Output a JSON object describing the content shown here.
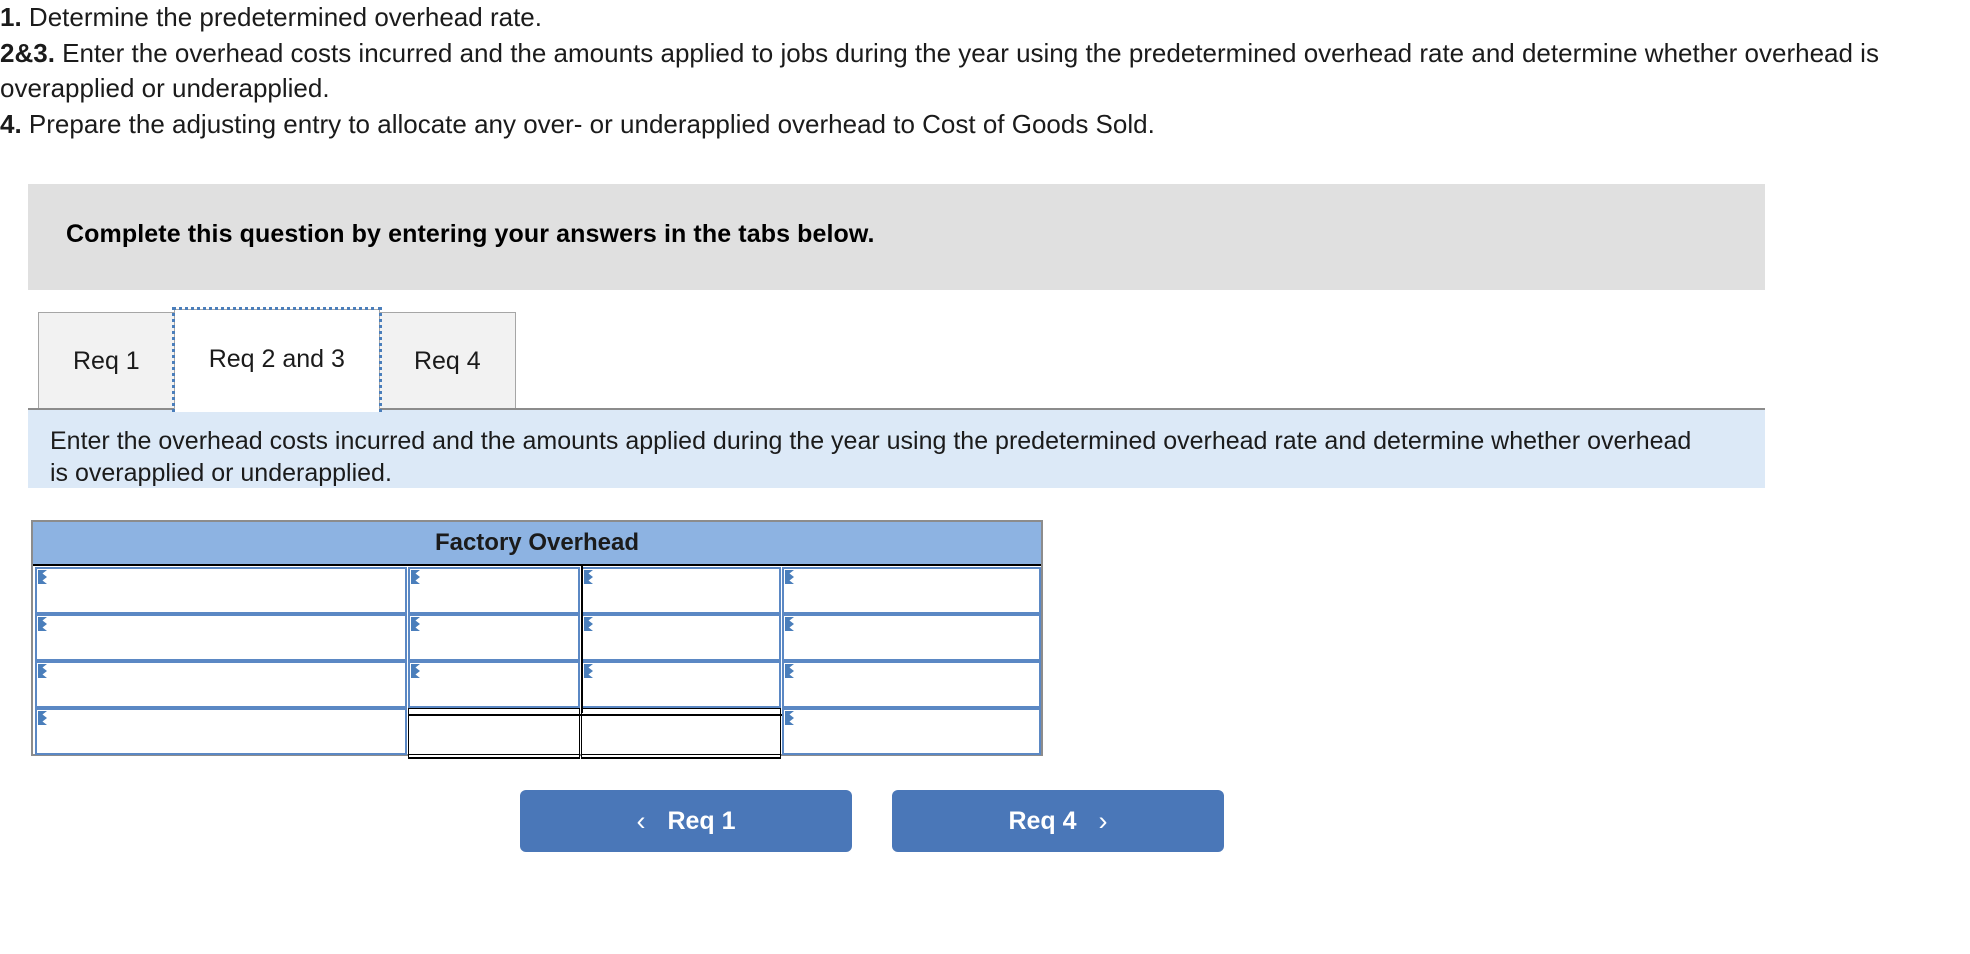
{
  "requirements": [
    {
      "num": "1.",
      "text": " Determine the predetermined overhead rate."
    },
    {
      "num": "2&3.",
      "text": " Enter the overhead costs incurred and the amounts applied to jobs during the year using the predetermined overhead rate and determine whether overhead is overapplied or underapplied."
    },
    {
      "num": "4.",
      "text": " Prepare the adjusting entry to allocate any over- or underapplied overhead to Cost of Goods Sold."
    }
  ],
  "banner": {
    "text": "Complete this question by entering your answers in the tabs below."
  },
  "tabs": [
    {
      "label": "Req 1",
      "active": false
    },
    {
      "label": "Req 2 and 3",
      "active": true
    },
    {
      "label": "Req 4",
      "active": false
    }
  ],
  "instruction": {
    "text": "Enter the overhead costs incurred and the amounts applied during the year using the predetermined overhead rate and determine whether overhead is overapplied or underapplied."
  },
  "t_account": {
    "title": "Factory Overhead",
    "rows": [
      {
        "cells": [
          {
            "value": "",
            "input": true
          },
          {
            "value": "",
            "input": true
          },
          {
            "value": "",
            "input": true
          },
          {
            "value": "",
            "input": true
          }
        ]
      },
      {
        "cells": [
          {
            "value": "",
            "input": true
          },
          {
            "value": "",
            "input": true
          },
          {
            "value": "",
            "input": true
          },
          {
            "value": "",
            "input": true
          }
        ]
      },
      {
        "cells": [
          {
            "value": "",
            "input": true
          },
          {
            "value": "",
            "input": true
          },
          {
            "value": "",
            "input": true
          },
          {
            "value": "",
            "input": true
          }
        ]
      },
      {
        "total": true,
        "cells": [
          {
            "value": "",
            "input": true
          },
          {
            "value": "",
            "input": false
          },
          {
            "value": "",
            "input": false
          },
          {
            "value": "",
            "input": true
          }
        ]
      }
    ]
  },
  "nav": {
    "prev": {
      "label": "Req 1",
      "icon": "chevron-left-icon",
      "glyph": "‹"
    },
    "next": {
      "label": "Req 4",
      "icon": "chevron-right-icon",
      "glyph": "›"
    }
  },
  "colors": {
    "banner_gray": "#e0e0e0",
    "instruction_blue": "#dce9f7",
    "table_header_blue": "#8db3e2",
    "cell_border_blue": "#5b88c4",
    "button_blue": "#4a77b8",
    "focus_ring_blue": "#4a7ebb",
    "tab_inactive": "#f2f2f2"
  }
}
